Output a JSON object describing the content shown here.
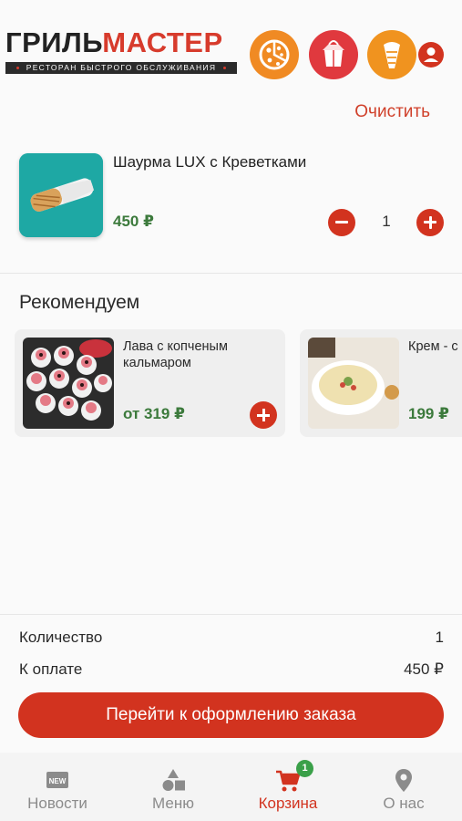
{
  "header": {
    "logo_part1": "ГРИЛЬ",
    "logo_part2": "МАСТЕР",
    "logo_tagline": "РЕСТОРАН БЫСТРОГО ОБСЛУЖИВАНИЯ",
    "categories": [
      {
        "icon": "pizza-icon",
        "color": "#f08a23"
      },
      {
        "icon": "takeaway-box-icon",
        "color": "#e0393e"
      },
      {
        "icon": "shawarma-icon",
        "color": "#f0931f"
      }
    ],
    "profile_icon": "user-icon"
  },
  "cart": {
    "clear_label": "Очистить",
    "items": [
      {
        "name": "Шаурма LUX с Креветками",
        "price": "450 ₽",
        "quantity": "1"
      }
    ]
  },
  "recommend": {
    "title": "Рекомендуем",
    "items": [
      {
        "name": "Лава с копченым кальмаром",
        "price": "от 319 ₽"
      },
      {
        "name": "Крем - с",
        "price": "199 ₽"
      }
    ]
  },
  "summary": {
    "qty_label": "Количество",
    "qty_value": "1",
    "pay_label": "К оплате",
    "pay_value": "450 ₽",
    "checkout_label": "Перейти к оформлению заказа"
  },
  "nav": {
    "items": [
      {
        "label": "Новости",
        "icon": "news-icon"
      },
      {
        "label": "Меню",
        "icon": "shapes-icon"
      },
      {
        "label": "Корзина",
        "icon": "cart-icon",
        "badge": "1"
      },
      {
        "label": "О нас",
        "icon": "location-pin-icon"
      }
    ]
  },
  "colors": {
    "accent": "#d2331f",
    "price": "#3c7a3c",
    "badge": "#3aa049"
  }
}
